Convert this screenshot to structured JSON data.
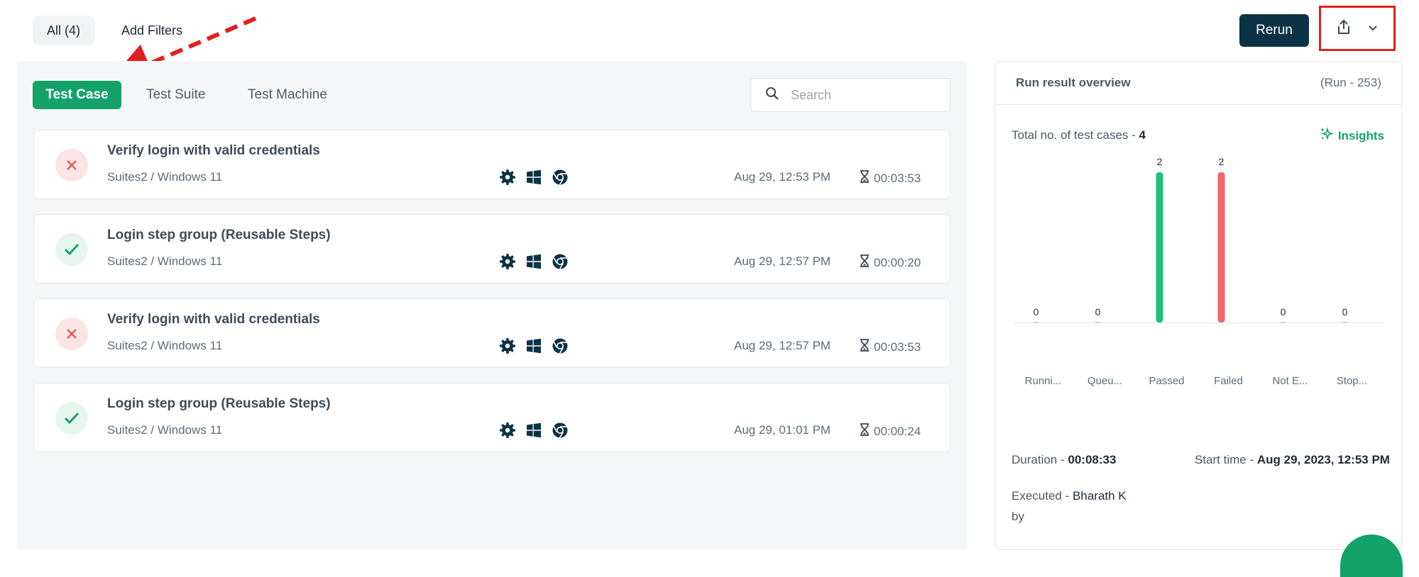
{
  "filters": {
    "all_label": "All (4)",
    "add_label": "Add Filters"
  },
  "toolbar": {
    "rerun_label": "Rerun"
  },
  "tabs": [
    {
      "label": "Test Case"
    },
    {
      "label": "Test Suite"
    },
    {
      "label": "Test Machine"
    }
  ],
  "search": {
    "placeholder": "Search"
  },
  "rows": [
    {
      "status": "failed",
      "title": "Verify login with valid credentials",
      "sub": "Suites2 / Windows 11",
      "date": "Aug 29, 12:53 PM",
      "duration": "00:03:53"
    },
    {
      "status": "passed",
      "title": "Login step group (Reusable Steps)",
      "sub": "Suites2 / Windows 11",
      "date": "Aug 29, 12:57 PM",
      "duration": "00:00:20"
    },
    {
      "status": "failed",
      "title": "Verify login with valid credentials",
      "sub": "Suites2 / Windows 11",
      "date": "Aug 29, 12:57 PM",
      "duration": "00:03:53"
    },
    {
      "status": "passed",
      "title": "Login step group (Reusable Steps)",
      "sub": "Suites2 / Windows 11",
      "date": "Aug 29, 01:01 PM",
      "duration": "00:00:24"
    }
  ],
  "overview": {
    "title": "Run result overview",
    "run": "(Run - 253)",
    "total_label": "Total no. of test cases -",
    "total_value": "4",
    "insights_label": "Insights",
    "duration_label": "Duration -",
    "duration_value": "00:08:33",
    "start_label": "Start time -",
    "start_value": "Aug 29, 2023, 12:53 PM",
    "executed_label": "Executed",
    "executed_sep": "-",
    "executed_value": "Bharath K",
    "executed_by": "by"
  },
  "chart_data": {
    "type": "bar",
    "categories": [
      "Runni...",
      "Queu...",
      "Passed",
      "Failed",
      "Not E...",
      "Stop..."
    ],
    "values": [
      0,
      0,
      2,
      2,
      0,
      0
    ],
    "colors": [
      "#c9d1da",
      "#c9d1da",
      "#1fbf7a",
      "#f06a6a",
      "#c9d1da",
      "#c9d1da"
    ],
    "ylim": [
      0,
      2
    ],
    "grid": false,
    "data_labels": true
  },
  "colors": {
    "brand_green": "#12a26a",
    "dark_button": "#0c3345",
    "fail_red": "#e5484d",
    "highlight_red": "#e02020"
  },
  "icons": {
    "env": [
      "gear-icon",
      "windows-icon",
      "chrome-icon"
    ],
    "duration": "hourglass-icon",
    "search": "search-icon",
    "export": "share-icon",
    "dropdown": "chevron-down-icon"
  }
}
